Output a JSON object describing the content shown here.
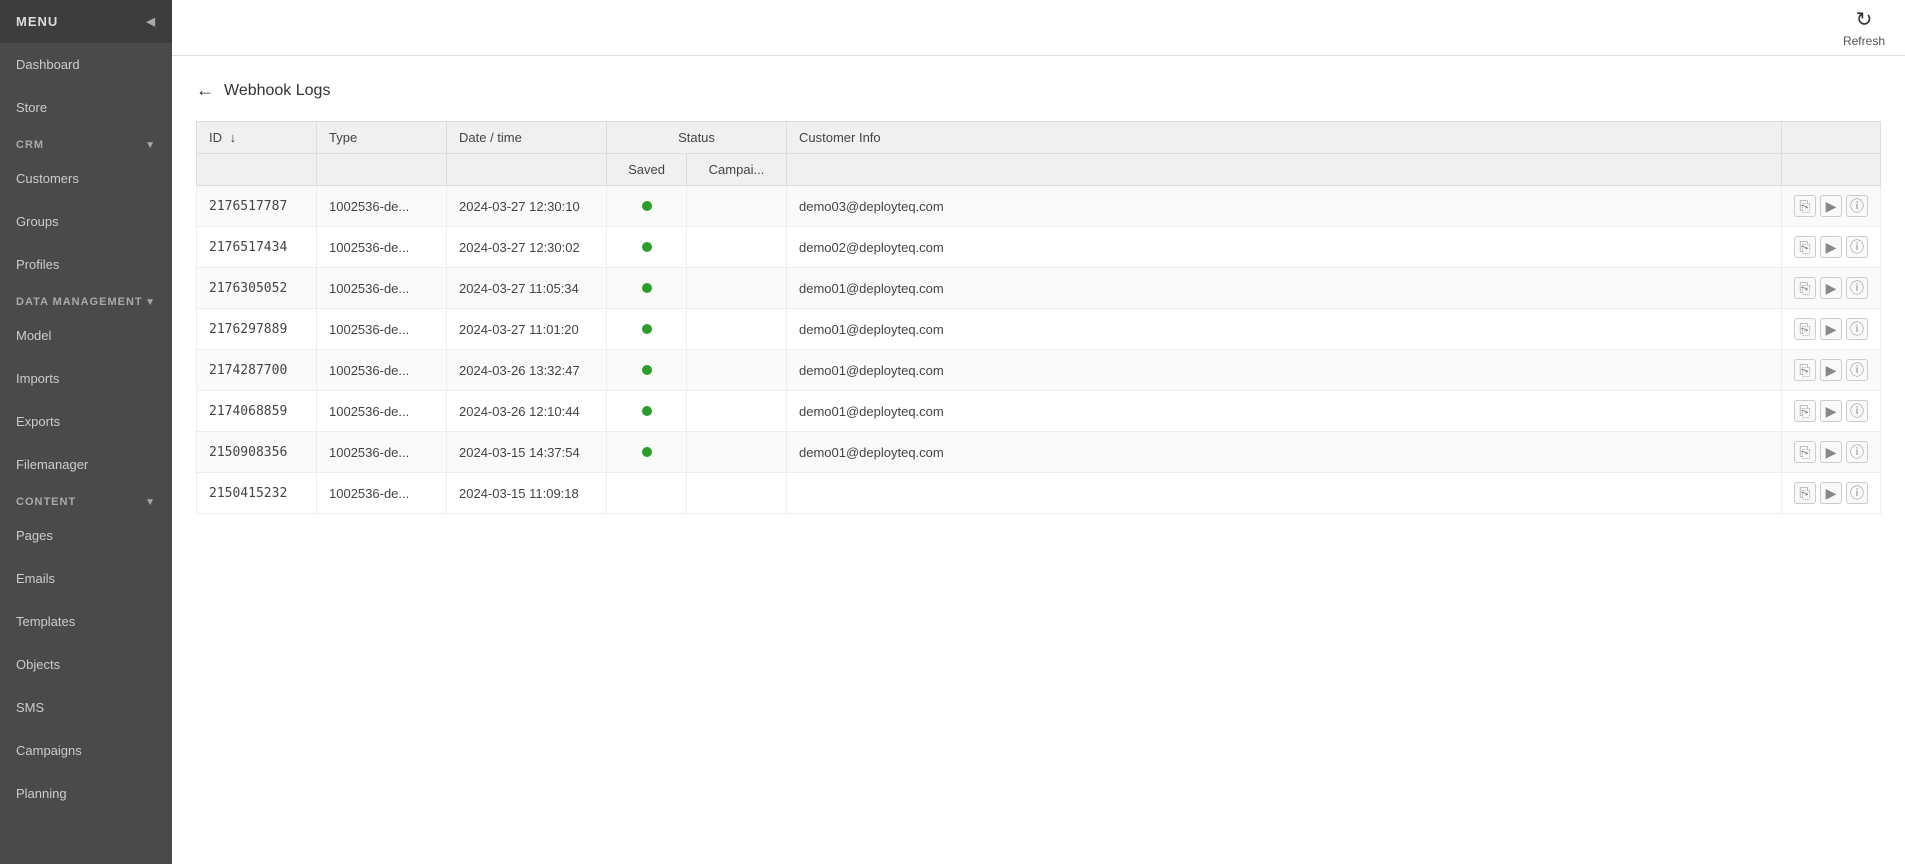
{
  "sidebar": {
    "menu_label": "MENU",
    "items": [
      {
        "label": "Dashboard",
        "name": "dashboard"
      },
      {
        "label": "Store",
        "name": "store"
      }
    ],
    "crm_section": "CRM",
    "crm_items": [
      {
        "label": "Customers",
        "name": "customers"
      },
      {
        "label": "Groups",
        "name": "groups"
      },
      {
        "label": "Profiles",
        "name": "profiles"
      }
    ],
    "data_mgmt_section": "DATA MANAGEMENT",
    "data_mgmt_items": [
      {
        "label": "Model",
        "name": "model"
      },
      {
        "label": "Imports",
        "name": "imports"
      },
      {
        "label": "Exports",
        "name": "exports"
      },
      {
        "label": "Filemanager",
        "name": "filemanager"
      }
    ],
    "content_section": "CONTENT",
    "content_items": [
      {
        "label": "Pages",
        "name": "pages"
      },
      {
        "label": "Emails",
        "name": "emails"
      },
      {
        "label": "Templates",
        "name": "templates"
      },
      {
        "label": "Objects",
        "name": "objects"
      },
      {
        "label": "SMS",
        "name": "sms"
      },
      {
        "label": "Campaigns",
        "name": "campaigns"
      },
      {
        "label": "Planning",
        "name": "planning"
      }
    ]
  },
  "topbar": {
    "refresh_label": "Refresh"
  },
  "page": {
    "title": "Webhook Logs",
    "back_label": "←"
  },
  "table": {
    "headers": {
      "id": "ID",
      "type": "Type",
      "date_time": "Date / time",
      "status": "Status",
      "saved": "Saved",
      "campaign": "Campai...",
      "customer_info": "Customer Info"
    },
    "rows": [
      {
        "id": "2176517787",
        "type": "1002536-de...",
        "date": "2024-03-27 12:30:10",
        "saved": true,
        "campaign": false,
        "customer": "demo03@deployteq.com"
      },
      {
        "id": "2176517434",
        "type": "1002536-de...",
        "date": "2024-03-27 12:30:02",
        "saved": true,
        "campaign": false,
        "customer": "demo02@deployteq.com"
      },
      {
        "id": "2176305052",
        "type": "1002536-de...",
        "date": "2024-03-27 11:05:34",
        "saved": true,
        "campaign": false,
        "customer": "demo01@deployteq.com"
      },
      {
        "id": "2176297889",
        "type": "1002536-de...",
        "date": "2024-03-27 11:01:20",
        "saved": true,
        "campaign": false,
        "customer": "demo01@deployteq.com"
      },
      {
        "id": "2174287700",
        "type": "1002536-de...",
        "date": "2024-03-26 13:32:47",
        "saved": true,
        "campaign": false,
        "customer": "demo01@deployteq.com"
      },
      {
        "id": "2174068859",
        "type": "1002536-de...",
        "date": "2024-03-26 12:10:44",
        "saved": true,
        "campaign": false,
        "customer": "demo01@deployteq.com"
      },
      {
        "id": "2150908356",
        "type": "1002536-de...",
        "date": "2024-03-15 14:37:54",
        "saved": true,
        "campaign": false,
        "customer": "demo01@deployteq.com"
      },
      {
        "id": "2150415232",
        "type": "1002536-de...",
        "date": "2024-03-15 11:09:18",
        "saved": false,
        "campaign": false,
        "customer": ""
      }
    ]
  }
}
